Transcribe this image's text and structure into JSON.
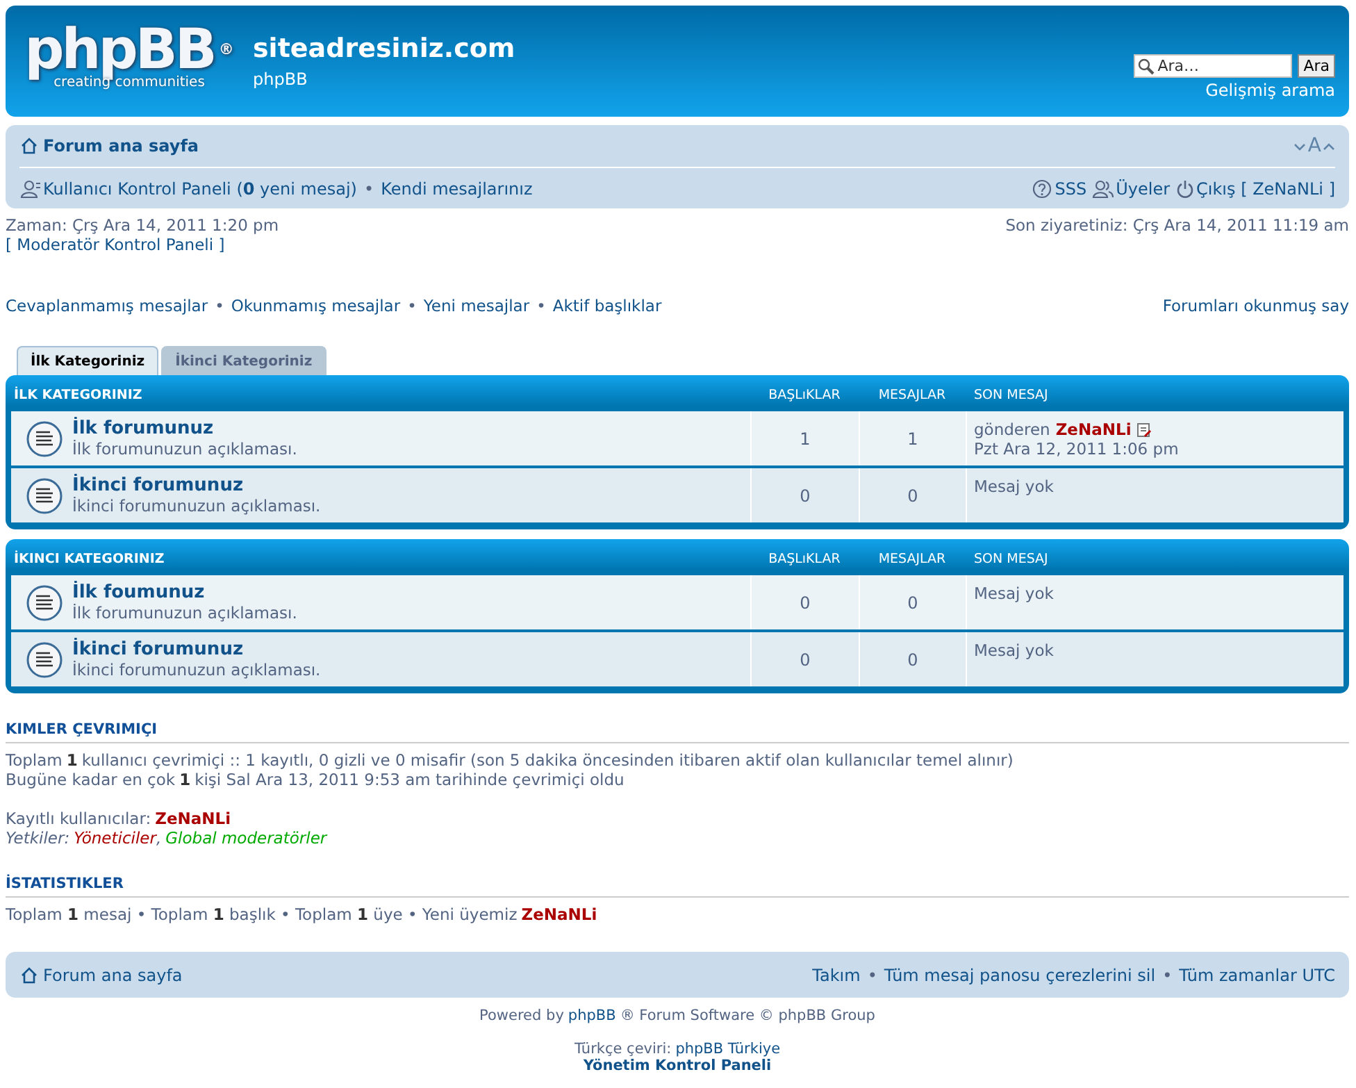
{
  "header": {
    "logo": {
      "wordmark": "phpBB",
      "registered": "®",
      "tagline": "creating communities"
    },
    "site_title": "siteadresiniz.com",
    "site_description": "phpBB",
    "search": {
      "placeholder": "Ara…",
      "button": "Ara",
      "advanced": "Gelişmiş arama"
    }
  },
  "navbar": {
    "breadcrumb": "Forum ana sayfa",
    "font_size": "A",
    "left_links": [
      {
        "kind": "user",
        "text": "Kullanıcı Kontrol Paneli (**0** yeni mesaj)"
      },
      {
        "kind": "plain",
        "text": "Kendi mesajlarınız"
      }
    ],
    "right_links": [
      {
        "kind": "faq",
        "text": "SSS"
      },
      {
        "kind": "members",
        "text": "Üyeler"
      },
      {
        "kind": "logout",
        "text": "Çıkış [ ZeNaNLi ]"
      }
    ]
  },
  "separator": "•",
  "time_info": {
    "current": "Zaman: Çrş Ara 14, 2011 1:20 pm",
    "moderator_link": "[ Moderatör Kontrol Paneli ]",
    "last_visit": "Son ziyaretiniz: Çrş Ara 14, 2011 11:19 am"
  },
  "search_links": [
    "Cevaplanmamış mesajlar",
    "Okunmamış mesajlar",
    "Yeni mesajlar",
    "Aktif başlıklar"
  ],
  "mark_read": "Forumları okunmuş say",
  "tabs": [
    {
      "label": "İlk Kategoriniz",
      "selected": true
    },
    {
      "label": "İkinci Kategoriniz",
      "selected": false
    }
  ],
  "categories": [
    {
      "title": "İLK KATEGORINIZ",
      "columns": [
        "BAŞLıKLAR",
        "MESAJLAR",
        "SON MESAJ"
      ],
      "forums": [
        {
          "name": "İlk forumunuz",
          "description": "İlk forumunuzun açıklaması.",
          "topics": "1",
          "posts": "1",
          "last_post": {
            "kind": "post",
            "by": "gönderen",
            "author": "ZeNaNLi",
            "date": "Pzt Ara 12, 2011 1:06 pm"
          }
        },
        {
          "name": "İkinci forumunuz",
          "description": "İkinci forumunuzun açıklaması.",
          "topics": "0",
          "posts": "0",
          "last_post": {
            "kind": "none",
            "text": "Mesaj yok"
          }
        }
      ]
    },
    {
      "title": "İKINCI KATEGORINIZ",
      "columns": [
        "BAŞLıKLAR",
        "MESAJLAR",
        "SON MESAJ"
      ],
      "forums": [
        {
          "name": "İlk foumunuz",
          "description": "İlk forumunuzun açıklaması.",
          "topics": "0",
          "posts": "0",
          "last_post": {
            "kind": "none",
            "text": "Mesaj yok"
          }
        },
        {
          "name": "İkinci forumunuz",
          "description": "İkinci forumunuzun açıklaması.",
          "topics": "0",
          "posts": "0",
          "last_post": {
            "kind": "none",
            "text": "Mesaj yok"
          }
        }
      ]
    }
  ],
  "online": {
    "title": "KIMLER ÇEVRIMIÇI",
    "lines": [
      "Toplam **1** kullanıcı çevrimiçi :: 1 kayıtlı, 0 gizli ve 0 misafir (son 5 dakika öncesinden itibaren aktif olan kullanıcılar temel alınır)",
      "Bugüne kadar en çok **1** kişi Sal Ara 13, 2011 9:53 am tarihinde çevrimiçi oldu"
    ],
    "registered_label": "Kayıtlı kullanıcılar:",
    "registered_users": [
      "ZeNaNLi"
    ],
    "legend_label": "Yetkiler:",
    "group_separator": ",",
    "groups": [
      {
        "name": "Yöneticiler",
        "color": "#aa0000"
      },
      {
        "name": "Global moderatörler",
        "color": "#00aa00"
      }
    ]
  },
  "statistics": {
    "title": "İSTATISTIKLER",
    "text": "Toplam **1** mesaj • Toplam **1** başlık • Toplam **1** üye • Yeni üyemiz",
    "newest_member": "ZeNaNLi"
  },
  "footer_nav": {
    "breadcrumb": "Forum ana sayfa",
    "links": [
      "Takım",
      "Tüm mesaj panosu çerezlerini sil",
      "Tüm zamanlar UTC"
    ]
  },
  "copyright": {
    "powered": "Powered by",
    "phpbb_link": "phpBB",
    "rest": "® Forum Software © phpBB Group",
    "translation": "Türkçe çeviri:",
    "translation_link": "phpBB Türkiye",
    "acp": "Yönetim Kontrol Paneli"
  }
}
